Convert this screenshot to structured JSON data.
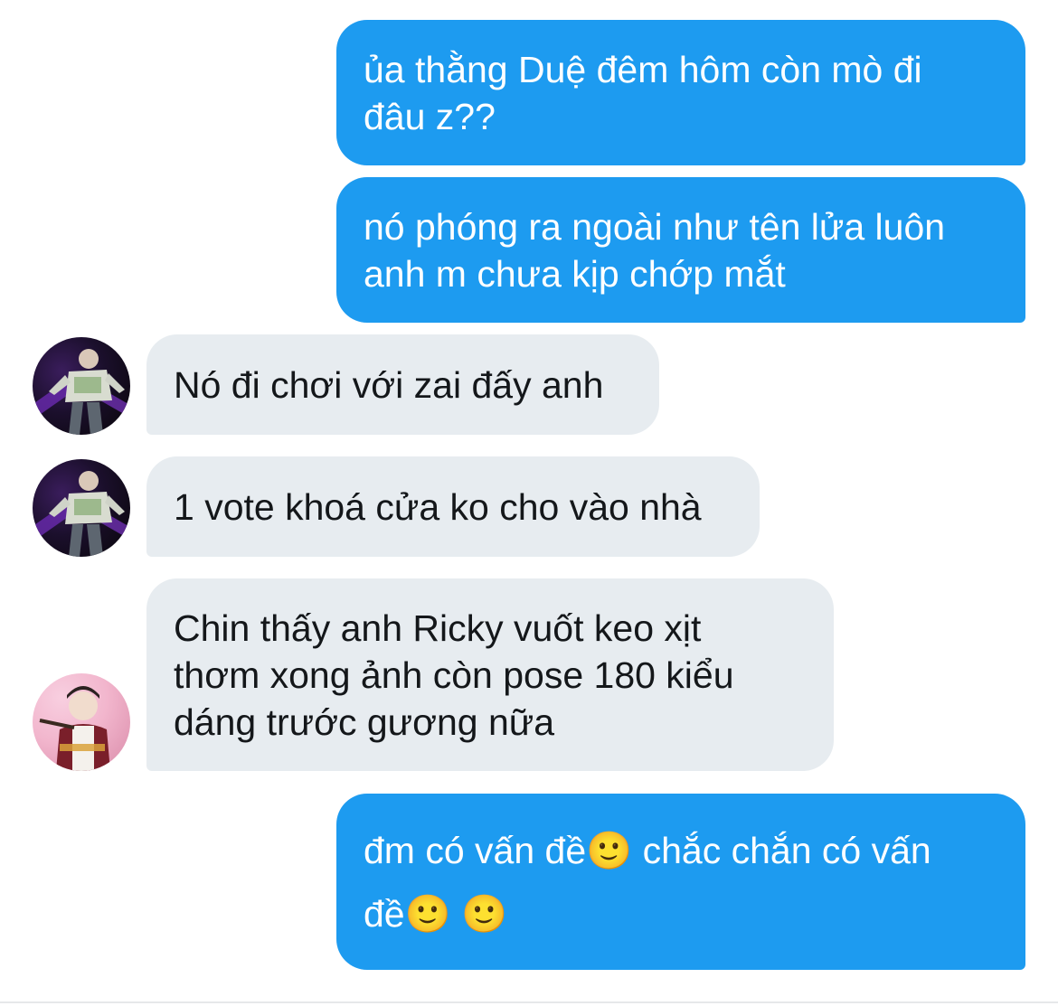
{
  "messages": [
    {
      "direction": "outgoing",
      "text": "ủa thằng Duệ đêm hôm còn mò đi\nđâu z??"
    },
    {
      "direction": "outgoing",
      "text": "nó phóng ra ngoài như tên lửa luôn\nanh m chưa kịp chớp mắt"
    },
    {
      "direction": "incoming",
      "avatar": "avatar-dark-stage",
      "text": "Nó đi chơi với zai đấy anh"
    },
    {
      "direction": "incoming",
      "avatar": "avatar-dark-stage",
      "text": "1 vote khoá cửa ko cho vào nhà"
    },
    {
      "direction": "incoming",
      "avatar": "avatar-pink-stage",
      "text": "Chin thấy anh Ricky vuốt keo xịt\nthơm xong ảnh còn pose 180 kiểu\ndáng trước gương nữa"
    },
    {
      "direction": "outgoing",
      "text_parts": [
        "đm có vấn đề",
        "🙂",
        "  chắc chắn có vấn\nđề",
        "🙂",
        " ",
        "🙂"
      ]
    }
  ],
  "colors": {
    "outgoing_bubble": "#1d9bf0",
    "incoming_bubble": "#e7ecf0",
    "outgoing_text": "#ffffff",
    "incoming_text": "#14171a"
  }
}
